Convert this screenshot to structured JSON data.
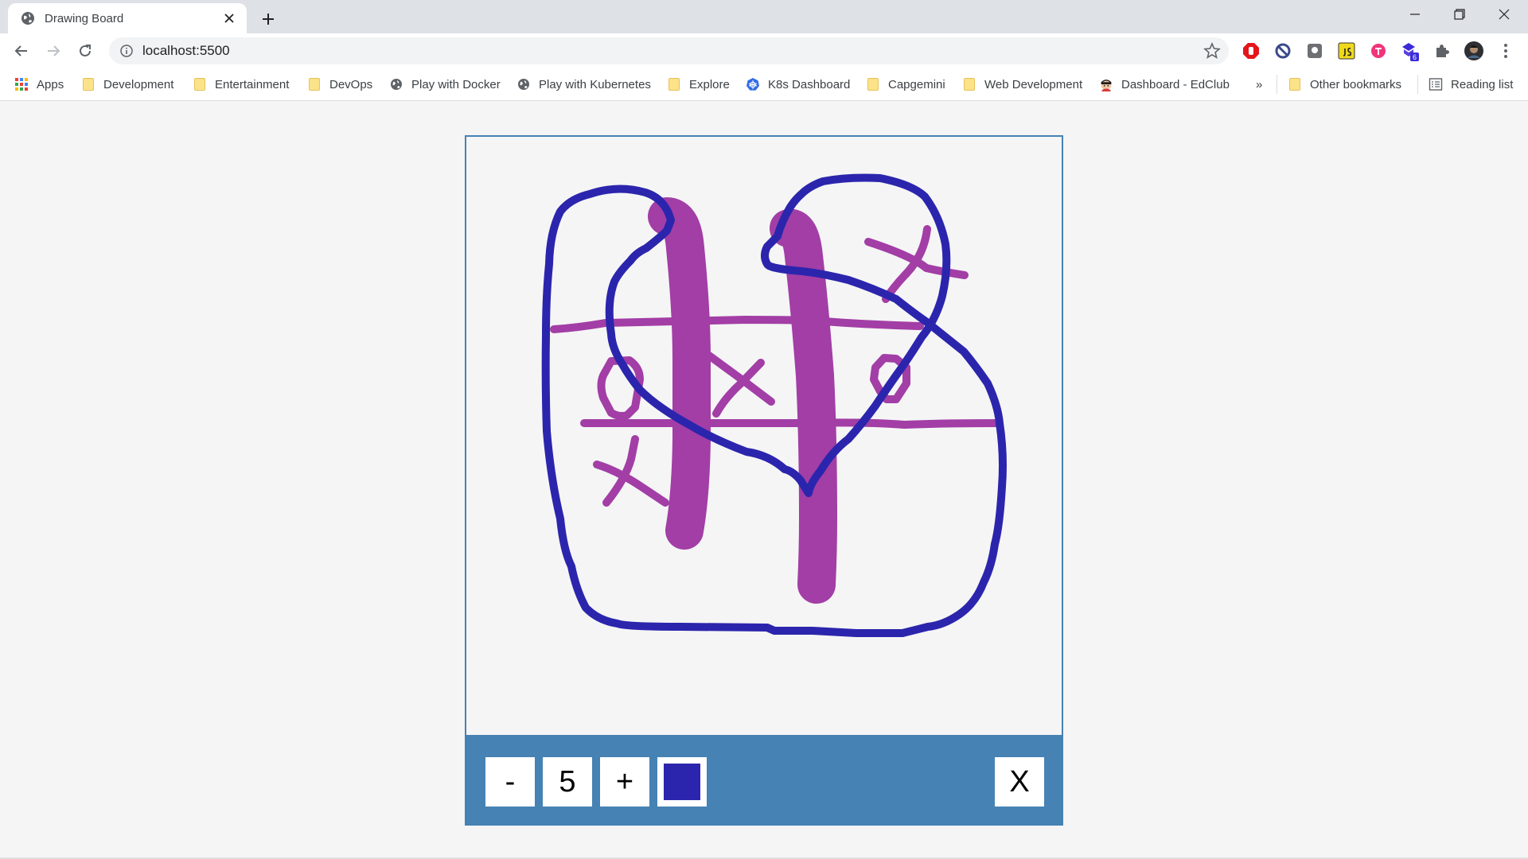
{
  "browser": {
    "tab_title": "Drawing Board",
    "url": "localhost:5500",
    "extension_badge": "6",
    "bookmarks": [
      {
        "label": "Apps",
        "icon": "apps-grid-icon"
      },
      {
        "label": "Development",
        "icon": "folder-icon"
      },
      {
        "label": "Entertainment",
        "icon": "folder-icon"
      },
      {
        "label": "DevOps",
        "icon": "folder-icon"
      },
      {
        "label": "Play with Docker",
        "icon": "globe-icon"
      },
      {
        "label": "Play with Kubernetes",
        "icon": "globe-icon"
      },
      {
        "label": "Explore",
        "icon": "folder-icon"
      },
      {
        "label": "K8s Dashboard",
        "icon": "kubernetes-icon"
      },
      {
        "label": "Capgemini",
        "icon": "folder-icon"
      },
      {
        "label": "Web Development",
        "icon": "folder-icon"
      },
      {
        "label": "Dashboard - EdClub",
        "icon": "edclub-icon"
      }
    ],
    "overflow_label": "»",
    "other_bookmarks": "Other bookmarks",
    "reading_list": "Reading list"
  },
  "app": {
    "decrease_label": "-",
    "brush_size": "5",
    "increase_label": "+",
    "clear_label": "X",
    "brush_color": "#2b25ad",
    "stroke_colors": {
      "purple": "#a23ea6",
      "blue": "#2b25ad"
    }
  }
}
